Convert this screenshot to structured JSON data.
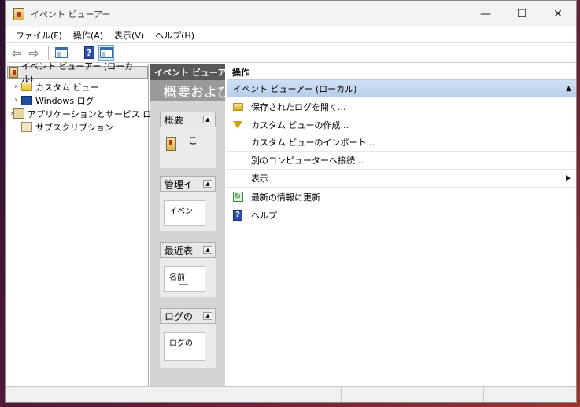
{
  "window": {
    "title": "イベント ビューアー",
    "controls": {
      "minimize": "—",
      "maximize": "☐",
      "close": "✕"
    }
  },
  "menu": {
    "items": [
      "ファイル(F)",
      "操作(A)",
      "表示(V)",
      "ヘルプ(H)"
    ]
  },
  "toolbar": {
    "back_icon": "back-arrow-icon",
    "forward_icon": "forward-arrow-icon",
    "back": "⇦",
    "forward": "⇨",
    "help": "?"
  },
  "tree": {
    "root": "イベント ビューアー (ローカル)",
    "items": [
      {
        "label": "カスタム ビュー",
        "chevron": "›"
      },
      {
        "label": "Windows ログ",
        "chevron": "›"
      },
      {
        "label": "アプリケーションとサービス ログ",
        "chevron": "›"
      },
      {
        "label": "サブスクリプション",
        "chevron": ""
      }
    ]
  },
  "middle": {
    "header": "イベント ビューア...",
    "banner": "概要および",
    "sections": [
      {
        "title": "概要",
        "body": "こ",
        "collapse": "▲"
      },
      {
        "title": "管理イ",
        "body": "イベン",
        "collapse": "▲"
      },
      {
        "title": "最近表",
        "body": "名前",
        "collapse": "▲"
      },
      {
        "title": "ログの",
        "body": "ログの",
        "collapse": "▲"
      }
    ]
  },
  "actions": {
    "title": "操作",
    "group": "イベント ビューアー (ローカル)",
    "group_caret": "▲",
    "items": [
      {
        "label": "保存されたログを開く...",
        "icon": "open-folder-icon"
      },
      {
        "label": "カスタム ビューの作成...",
        "icon": "filter-icon"
      },
      {
        "label": "カスタム ビューのインポート...",
        "icon": ""
      },
      {
        "label": "別のコンピューターへ接続...",
        "icon": ""
      },
      {
        "label": "表示",
        "icon": "",
        "submenu": "▶"
      },
      {
        "label": "最新の情報に更新",
        "icon": "refresh-icon"
      },
      {
        "label": "ヘルプ",
        "icon": "help-icon"
      }
    ],
    "refresh_glyph": "↻",
    "help_glyph": "?"
  }
}
